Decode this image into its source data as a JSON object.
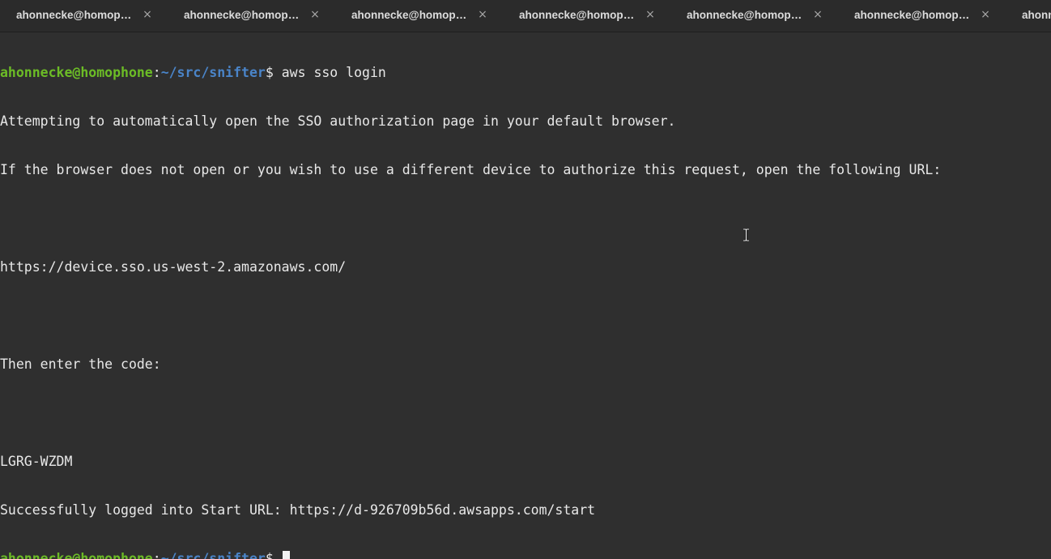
{
  "tabs": [
    {
      "label": "ahonnecke@homoph..."
    },
    {
      "label": "ahonnecke@homoph..."
    },
    {
      "label": "ahonnecke@homoph..."
    },
    {
      "label": "ahonnecke@homoph..."
    },
    {
      "label": "ahonnecke@homoph..."
    },
    {
      "label": "ahonnecke@homoph..."
    },
    {
      "label": "ahonne"
    }
  ],
  "tab_close_glyph": "×",
  "prompt": {
    "user_host": "ahonnecke@homophone",
    "colon": ":",
    "path": "~/src/snifter",
    "dollar": "$ "
  },
  "output": {
    "command": "aws sso login",
    "line1": "Attempting to automatically open the SSO authorization page in your default browser.",
    "line2": "If the browser does not open or you wish to use a different device to authorize this request, open the following URL:",
    "url": "https://device.sso.us-west-2.amazonaws.com/",
    "enter_code": "Then enter the code:",
    "code": "LGRG-WZDM",
    "success": "Successfully logged into Start URL: https://d-926709b56d.awsapps.com/start"
  },
  "colors": {
    "background": "#2f2f2f",
    "prompt_user": "#6cbc26",
    "prompt_path": "#4a84c8",
    "text": "#e8e8e8"
  }
}
